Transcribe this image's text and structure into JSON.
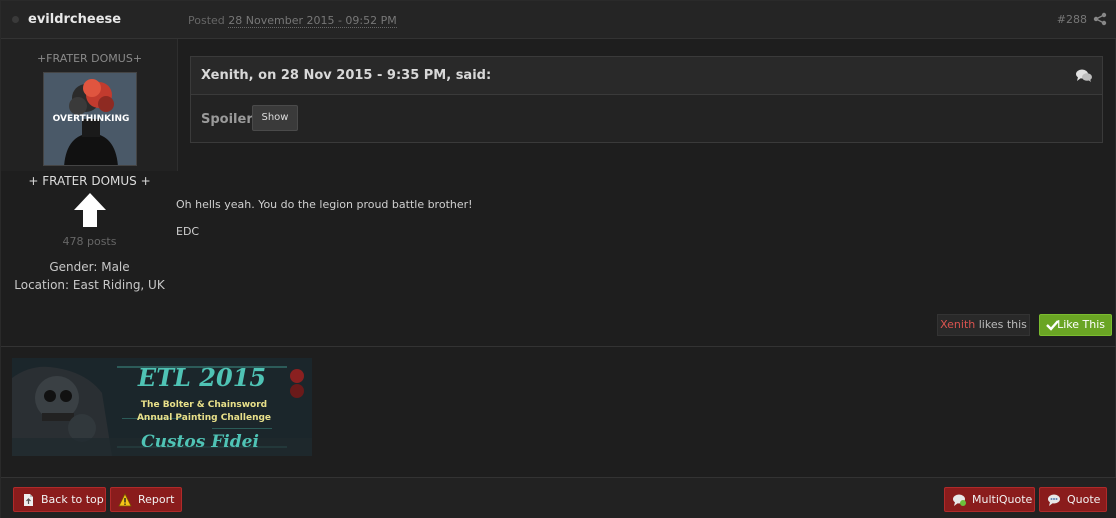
{
  "header": {
    "author": "evildrcheese",
    "posted_prefix": "Posted",
    "posted_date": "28 November 2015 - 09:52 PM",
    "post_number": "#288"
  },
  "author_panel": {
    "title_top": "+FRATER DOMUS+",
    "avatar_text": "OVERTHINKING",
    "group": "+ FRATER DOMUS +",
    "post_count": "478 posts",
    "gender": "Gender: Male",
    "location": "Location: East Riding, UK"
  },
  "quote": {
    "cite": "Xenith, on 28 Nov 2015 - 9:35 PM, said:",
    "spoiler_label": "Spoiler",
    "show_label": "Show"
  },
  "body": {
    "line1": "Oh hells yeah. You do the legion proud battle brother!",
    "line2": "EDC"
  },
  "likes": {
    "liker": "Xenith",
    "suffix": " likes this",
    "like_button": "Like This"
  },
  "signature": {
    "title": "ETL 2015",
    "line1": "The Bolter & Chainsword",
    "line2": "Annual Painting Challenge",
    "line3": "Custos Fidei"
  },
  "footer": {
    "back_to_top": "Back to top",
    "report": "Report",
    "multiquote": "MultiQuote",
    "quote": "Quote"
  },
  "colors": {
    "like_green": "#6aa524",
    "button_red": "#8a1c1c",
    "liker_red": "#d9534f"
  }
}
